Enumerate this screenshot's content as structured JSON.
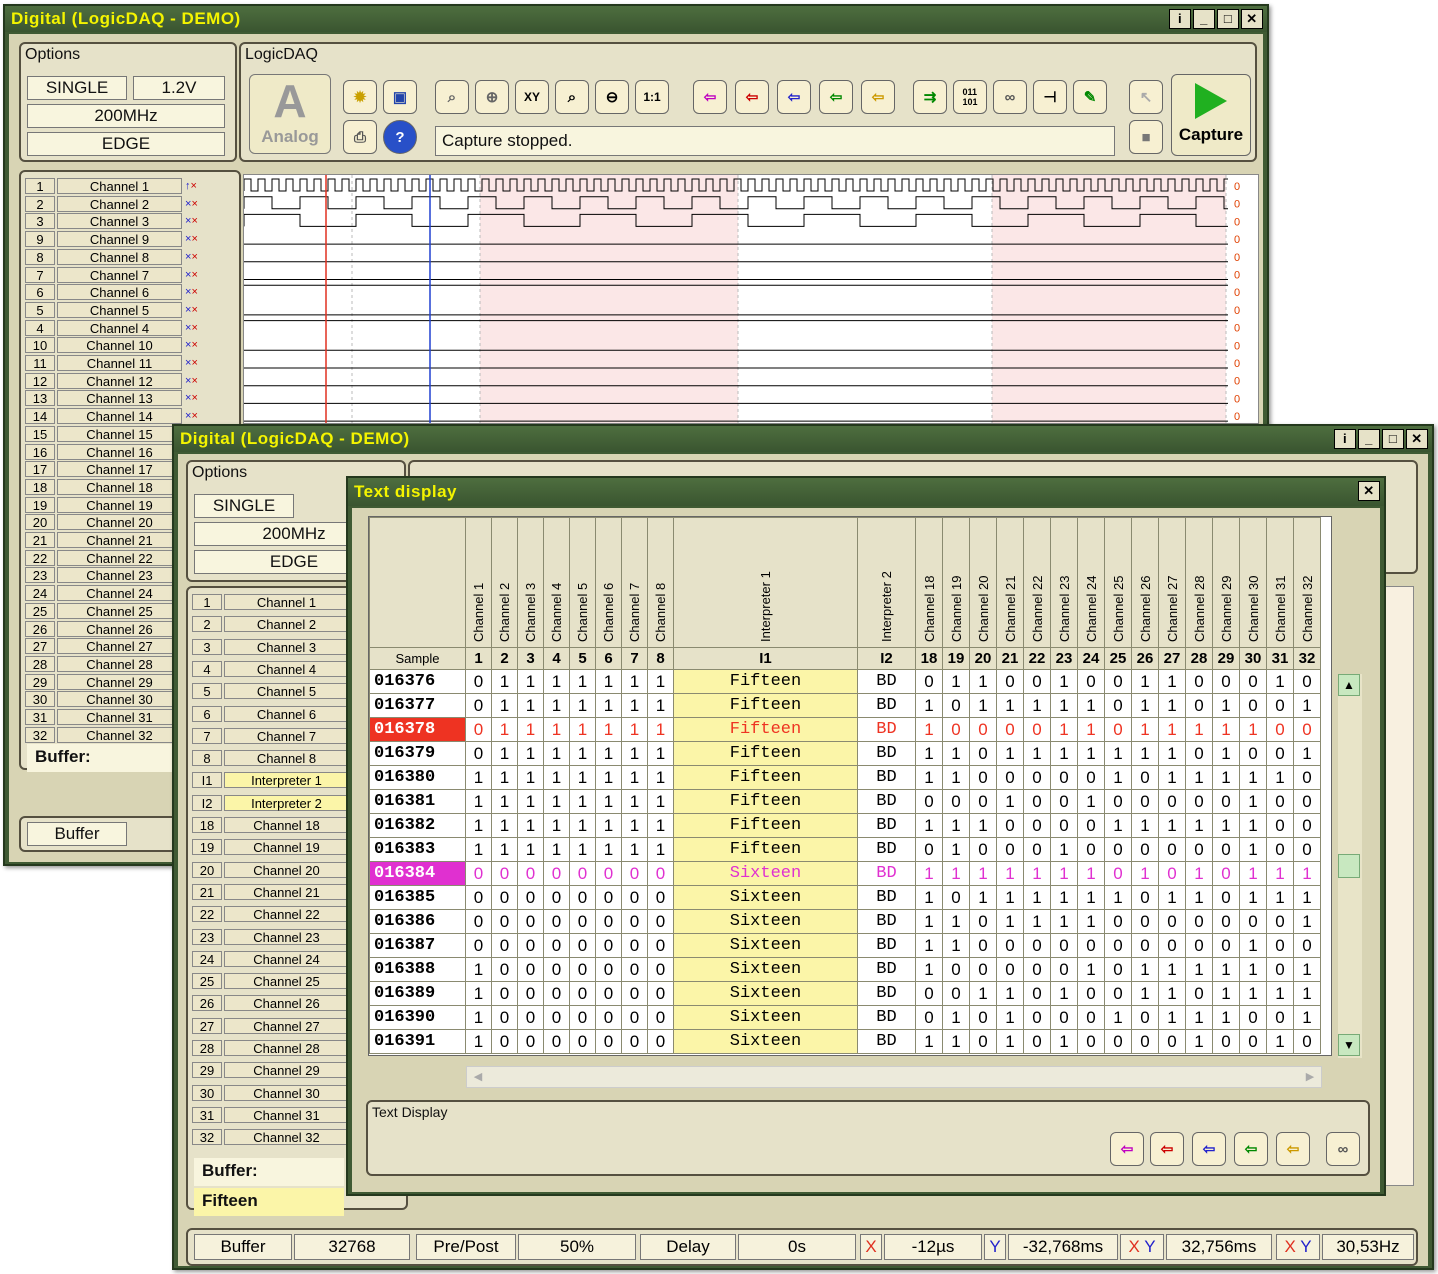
{
  "back": {
    "title": "Digital (LogicDAQ - DEMO)",
    "options_title": "Options",
    "single": "SINGLE",
    "volt": "1.2V",
    "freq": "200MHz",
    "edge": "EDGE",
    "logicdaq_title": "LogicDAQ",
    "analog": "Analog",
    "status": "Capture stopped.",
    "capture": "Capture",
    "buffer_label": "Buffer:",
    "buffer_btn": "Buffer",
    "channels": [
      [
        "1",
        "Channel 1"
      ],
      [
        "2",
        "Channel 2"
      ],
      [
        "3",
        "Channel 3"
      ],
      [
        "9",
        "Channel 9"
      ],
      [
        "8",
        "Channel 8"
      ],
      [
        "7",
        "Channel 7"
      ],
      [
        "6",
        "Channel 6"
      ],
      [
        "5",
        "Channel 5"
      ],
      [
        "4",
        "Channel 4"
      ],
      [
        "10",
        "Channel 10"
      ],
      [
        "11",
        "Channel 11"
      ],
      [
        "12",
        "Channel 12"
      ],
      [
        "13",
        "Channel 13"
      ],
      [
        "14",
        "Channel 14"
      ],
      [
        "15",
        "Channel 15"
      ],
      [
        "16",
        "Channel 16"
      ],
      [
        "17",
        "Channel 17"
      ],
      [
        "18",
        "Channel 18"
      ],
      [
        "19",
        "Channel 19"
      ],
      [
        "20",
        "Channel 20"
      ],
      [
        "21",
        "Channel 21"
      ],
      [
        "22",
        "Channel 22"
      ],
      [
        "23",
        "Channel 23"
      ],
      [
        "24",
        "Channel 24"
      ],
      [
        "25",
        "Channel 25"
      ],
      [
        "26",
        "Channel 26"
      ],
      [
        "27",
        "Channel 27"
      ],
      [
        "28",
        "Channel 28"
      ],
      [
        "29",
        "Channel 29"
      ],
      [
        "30",
        "Channel 30"
      ],
      [
        "31",
        "Channel 31"
      ],
      [
        "32",
        "Channel 32"
      ]
    ]
  },
  "front": {
    "title": "Digital (LogicDAQ - DEMO)",
    "options_title": "Options",
    "single": "SINGLE",
    "freq": "200MHz",
    "edge": "EDGE",
    "buffer_label": "Buffer:",
    "fifteen": "Fifteen",
    "channels": [
      [
        "1",
        "Channel 1"
      ],
      [
        "2",
        "Channel 2"
      ],
      [
        "3",
        "Channel 3"
      ],
      [
        "4",
        "Channel 4"
      ],
      [
        "5",
        "Channel 5"
      ],
      [
        "6",
        "Channel 6"
      ],
      [
        "7",
        "Channel 7"
      ],
      [
        "8",
        "Channel 8"
      ],
      [
        "I1",
        "Interpreter 1"
      ],
      [
        "I2",
        "Interpreter 2"
      ],
      [
        "18",
        "Channel 18"
      ],
      [
        "19",
        "Channel 19"
      ],
      [
        "20",
        "Channel 20"
      ],
      [
        "21",
        "Channel 21"
      ],
      [
        "22",
        "Channel 22"
      ],
      [
        "23",
        "Channel 23"
      ],
      [
        "24",
        "Channel 24"
      ],
      [
        "25",
        "Channel 25"
      ],
      [
        "26",
        "Channel 26"
      ],
      [
        "27",
        "Channel 27"
      ],
      [
        "28",
        "Channel 28"
      ],
      [
        "29",
        "Channel 29"
      ],
      [
        "30",
        "Channel 30"
      ],
      [
        "31",
        "Channel 31"
      ],
      [
        "32",
        "Channel 32"
      ]
    ],
    "status": {
      "buffer_label": "Buffer",
      "buffer_value": "32768",
      "prepost_label": "Pre/Post",
      "prepost_value": "50%",
      "delay_label": "Delay",
      "delay_value": "0s",
      "x_value": "-12µs",
      "y_value": "-32,768ms",
      "xy_value": "32,756ms",
      "freq_value": "30,53Hz"
    }
  },
  "dialog": {
    "title": "Text display",
    "footer_title": "Text Display",
    "headers": [
      "Channel 1",
      "Channel 2",
      "Channel 3",
      "Channel 4",
      "Channel 5",
      "Channel 6",
      "Channel 7",
      "Channel 8",
      "Interpreter 1",
      "Interpreter 2",
      "Channel 18",
      "Channel 19",
      "Channel 20",
      "Channel 21",
      "Channel 22",
      "Channel 23",
      "Channel 24",
      "Channel 25",
      "Channel 26",
      "Channel 27",
      "Channel 28",
      "Channel 29",
      "Channel 30",
      "Channel 31",
      "Channel 32"
    ],
    "subheaders": [
      "Sample",
      "1",
      "2",
      "3",
      "4",
      "5",
      "6",
      "7",
      "8",
      "I1",
      "I2",
      "18",
      "19",
      "20",
      "21",
      "22",
      "23",
      "24",
      "25",
      "26",
      "27",
      "28",
      "29",
      "30",
      "31",
      "32"
    ],
    "rows": [
      {
        "sample": "016376",
        "bits": "11111111",
        "i1": "Fifteen",
        "i2": "BD",
        "hi": "0110010011000100",
        "first": "0"
      },
      {
        "sample": "016377",
        "bits": "01111111",
        "i1": "Fifteen",
        "i2": "BD",
        "hi": "1011111011010011",
        "first": ""
      },
      {
        "sample": "016378",
        "bits": "01111111",
        "i1": "Fifteen",
        "i2": "BD",
        "hi": "1000011011111000",
        "first": "",
        "mark": "red"
      },
      {
        "sample": "016379",
        "bits": "01111111",
        "i1": "Fifteen",
        "i2": "BD",
        "hi": "1101111111010011",
        "first": ""
      },
      {
        "sample": "016380",
        "bits": "11111111",
        "i1": "Fifteen",
        "i2": "BD",
        "hi": "1100000101111101",
        "first": ""
      },
      {
        "sample": "016381",
        "bits": "11111111",
        "i1": "Fifteen",
        "i2": "BD",
        "hi": "0001001000001000",
        "first": ""
      },
      {
        "sample": "016382",
        "bits": "11111111",
        "i1": "Fifteen",
        "i2": "BD",
        "hi": "1110000111111000",
        "first": ""
      },
      {
        "sample": "016383",
        "bits": "11111111",
        "i1": "Fifteen",
        "i2": "BD",
        "hi": "0100010000001000",
        "first": ""
      },
      {
        "sample": "016384",
        "bits": "00000000",
        "i1": "Sixteen",
        "i2": "BD",
        "hi": "1111111010101110",
        "first": "",
        "mark": "magenta"
      },
      {
        "sample": "016385",
        "bits": "00000000",
        "i1": "Sixteen",
        "i2": "BD",
        "hi": "1011111101101110",
        "first": ""
      },
      {
        "sample": "016386",
        "bits": "00000000",
        "i1": "Sixteen",
        "i2": "BD",
        "hi": "1101111000000010",
        "first": ""
      },
      {
        "sample": "016387",
        "bits": "00000000",
        "i1": "Sixteen",
        "i2": "BD",
        "hi": "1100000000001001",
        "first": ""
      },
      {
        "sample": "016388",
        "bits": "10000000",
        "i1": "Sixteen",
        "i2": "BD",
        "hi": "1000001011111010",
        "first": ""
      },
      {
        "sample": "016389",
        "bits": "10000000",
        "i1": "Sixteen",
        "i2": "BD",
        "hi": "0011010011011111",
        "first": ""
      },
      {
        "sample": "016390",
        "bits": "10000000",
        "i1": "Sixteen",
        "i2": "BD",
        "hi": "0101000101110011",
        "first": ""
      },
      {
        "sample": "016391",
        "bits": "10000000",
        "i1": "Sixteen",
        "i2": "BD",
        "hi": "1101010000100101",
        "first": ""
      }
    ]
  },
  "colors": {
    "frame": "#3f5a33",
    "title_text": "#f4f400",
    "panel": "#e6e2c9",
    "highlight_yellow": "#fbf5a8",
    "red_mark": "#ee3322",
    "magenta_mark": "#e030d0",
    "wave_shade": "#fbe7e7"
  }
}
